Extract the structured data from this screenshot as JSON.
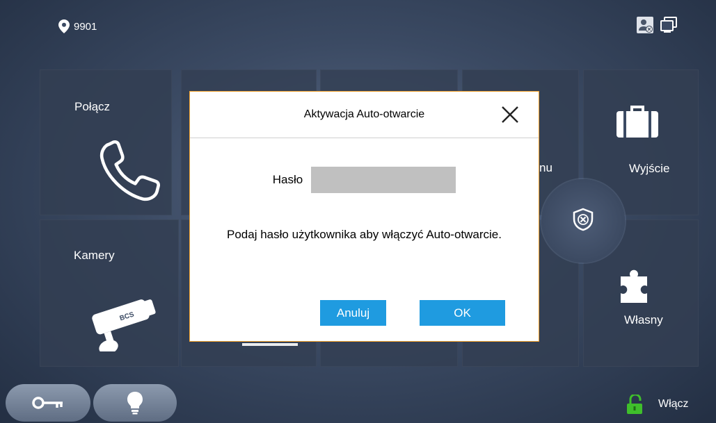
{
  "header": {
    "location_code": "9901"
  },
  "tiles": {
    "call": "Połącz",
    "cameras": "Kamery",
    "partial": "nu",
    "exit": "Wyjście",
    "custom": "Własny"
  },
  "bottom": {
    "unlock_label": "Włącz"
  },
  "dialog": {
    "title": "Aktywacja Auto-otwarcie",
    "password_label": "Hasło",
    "password_value": "",
    "hint": "Podaj hasło użytkownika aby włączyć Auto-otwarcie.",
    "cancel": "Anuluj",
    "ok": "OK"
  },
  "colors": {
    "button_blue": "#1f9be0",
    "dialog_border": "#f2a12b",
    "unlock_green": "#3fbf2b"
  },
  "icons": [
    "location-pin-icon",
    "user-offline-icon",
    "monitor-icon",
    "phone-icon",
    "camera-icon",
    "briefcase-icon",
    "puzzle-icon",
    "shield-x-icon",
    "key-icon",
    "bulb-icon",
    "unlock-icon",
    "close-icon"
  ]
}
